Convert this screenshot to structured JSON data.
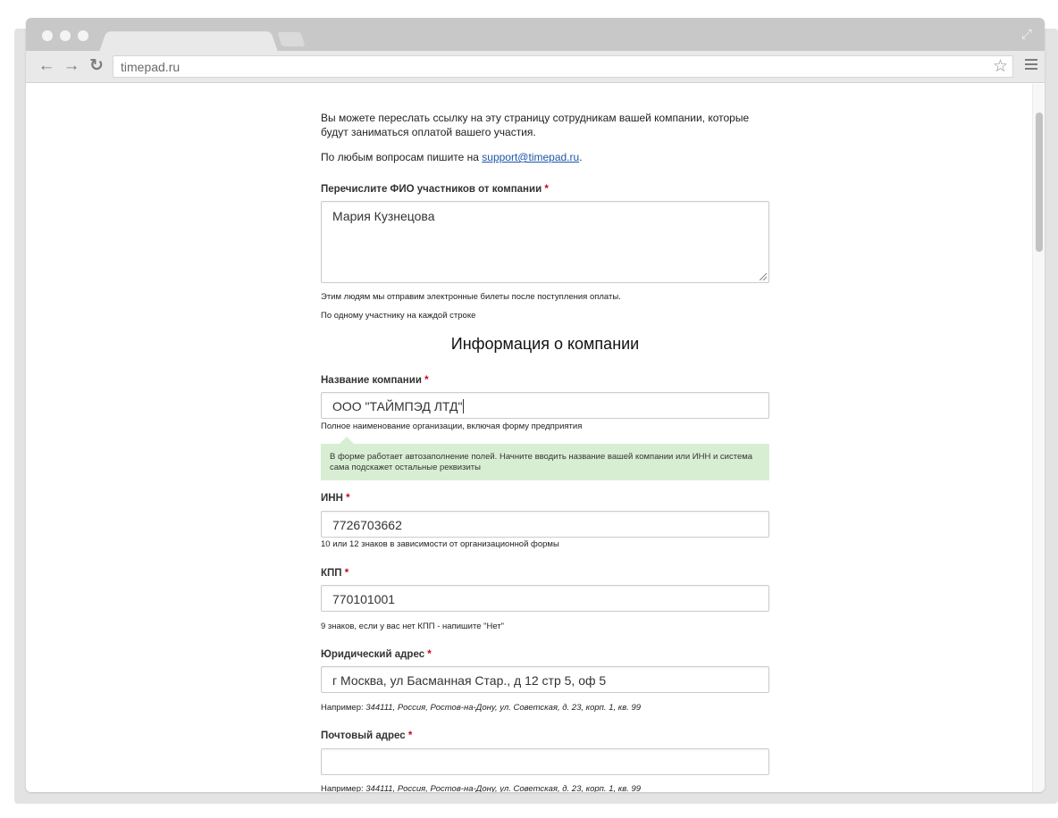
{
  "browser": {
    "url": "timepad.ru"
  },
  "page": {
    "intro_forward": "Вы можете переслать ссылку на эту страницу сотрудникам вашей компании, которые будут заниматься оплатой вашего участия.",
    "intro_questions_prefix": "По любым вопросам пишите на ",
    "support_email": "support@timepad.ru",
    "intro_questions_suffix": ".",
    "participants": {
      "label": "Перечислите ФИО участников от компании",
      "required_mark": "*",
      "value": "Мария Кузнецова",
      "hint_1": "Этим людям мы отправим электронные билеты после поступления оплаты.",
      "hint_2": "По одному участнику на каждой строке"
    },
    "section_title": "Информация о компании",
    "company_name": {
      "label": "Название компании",
      "required_mark": "*",
      "value": "ООО \"ТАЙМПЭД ЛТД\"",
      "hint": "Полное наименование организации, включая форму предприятия",
      "notice": "В форме работает автозаполнение полей. Начните вводить название вашей компании или ИНН и система сама подскажет остальные реквизиты"
    },
    "inn": {
      "label": "ИНН",
      "required_mark": "*",
      "value": "7726703662",
      "hint": "10 или 12 знаков в зависимости от организационной формы"
    },
    "kpp": {
      "label": "КПП",
      "required_mark": "*",
      "value": "770101001",
      "hint": "9 знаков, если у вас нет КПП - напишите \"Нет\""
    },
    "legal_address": {
      "label": "Юридический адрес",
      "required_mark": "*",
      "value": "г Москва, ул Басманная Стар., д 12 стр 5, оф 5",
      "hint_prefix": "Например: ",
      "hint_example": "344111, Россия, Ростов-на-Дону, ул. Советская, д. 23, корп. 1, кв. 99"
    },
    "postal_address": {
      "label": "Почтовый адрес",
      "required_mark": "*",
      "value": "",
      "hint_prefix": "Например: ",
      "hint_example": "344111, Россия, Ростов-на-Дону, ул. Советская, д. 23, корп. 1, кв. 99"
    }
  }
}
